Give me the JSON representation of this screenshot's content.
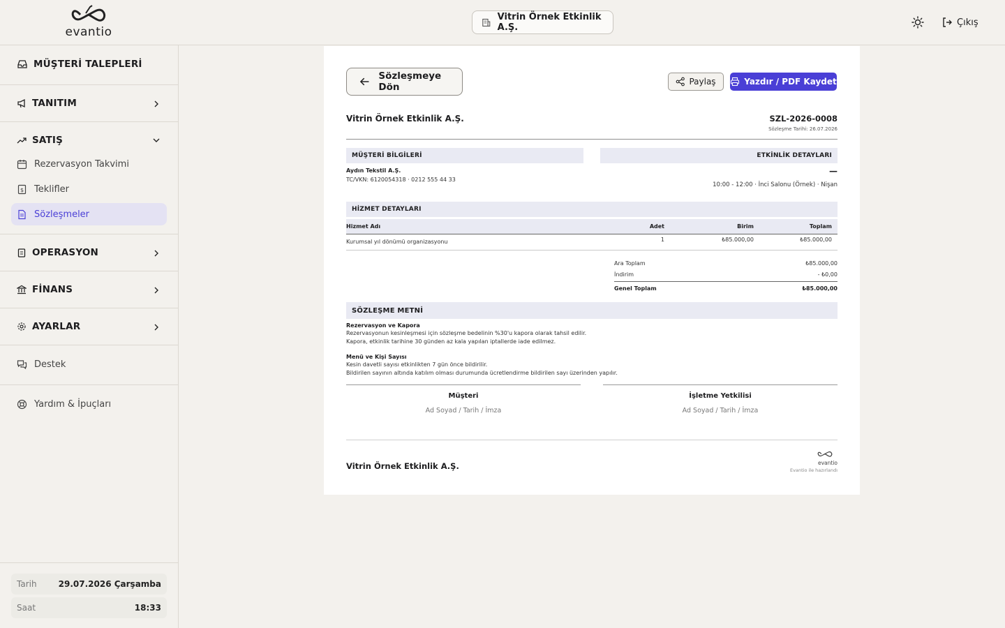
{
  "header": {
    "logo_text": "evantio",
    "company": "Vitrin Örnek Etkinlik A.Ş.",
    "logout_label": "Çıkış"
  },
  "sidebar": {
    "customer_requests": "MÜŞTERİ TALEPLERİ",
    "promotion": "TANITIM",
    "sales": "SATIŞ",
    "sales_items": [
      "Rezervasyon Takvimi",
      "Teklifler",
      "Sözleşmeler"
    ],
    "operation": "OPERASYON",
    "finance": "FİNANS",
    "settings": "AYARLAR",
    "support": "Destek",
    "help": "Yardım & İpuçları",
    "date_label": "Tarih",
    "date_value": "29.07.2026 Çarşamba",
    "time_label": "Saat",
    "time_value": "18:33"
  },
  "doc": {
    "back_label": "Sözleşmeye Dön",
    "share_label": "Paylaş",
    "print_label": "Yazdır / PDF Kaydet",
    "company": "Vitrin Örnek Etkinlik A.Ş.",
    "contract_no": "SZL-2026-0008",
    "contract_date": "Sözleşme Tarihi: 26.07.2026",
    "customer_title": "MÜŞTERİ BİLGİLERİ",
    "customer_name": "Aydın Tekstil A.Ş.",
    "customer_tax": "TC/VKN: 6120054318 · 0212 555 44 33",
    "event_title": "ETKİNLİK DETAYLARI",
    "event_dash": "—",
    "event_info": "10:00 - 12:00 · İnci Salonu (Örnek) · Nişan",
    "services_title": "HİZMET DETAYLARI",
    "col_name": "Hizmet Adı",
    "col_qty": "Adet",
    "col_unit": "Birim",
    "col_total": "Toplam",
    "rows": [
      {
        "name": "Kurumsal yıl dönümü organizasyonu",
        "qty": "1",
        "unit": "₺85.000,00",
        "total": "₺85.000,00"
      }
    ],
    "subtotal_label": "Ara Toplam",
    "subtotal_value": "₺85.000,00",
    "discount_label": "İndirim",
    "discount_value": "- ₺0,00",
    "grand_label": "Genel Toplam",
    "grand_value": "₺85.000,00",
    "contract_text_title": "SÖZLEŞME METNİ",
    "clause1_title": "Rezervasyon ve Kapora",
    "clause1_line1": "Rezervasyonun kesinleşmesi için sözleşme bedelinin %30'u kapora olarak tahsil edilir.",
    "clause1_line2": "Kapora, etkinlik tarihine 30 günden az kala yapılan iptallerde iade edilmez.",
    "clause2_title": "Menü ve Kişi Sayısı",
    "clause2_line1": "Kesin davetli sayısı etkinlikten 7 gün önce bildirilir.",
    "clause2_line2": "Bildirilen sayının altında katılım olması durumunda ücretlendirme bildirilen sayı üzerinden yapılır.",
    "sig_customer": "Müşteri",
    "sig_customer_sub": "Ad Soyad / Tarih / İmza",
    "sig_business": "İşletme Yetkilisi",
    "sig_business_sub": "Ad Soyad / Tarih / İmza",
    "footer_company": "Vitrin Örnek Etkinlik A.Ş.",
    "footer_logo": "evantio",
    "footer_note": "Evantio ile hazırlandı"
  }
}
